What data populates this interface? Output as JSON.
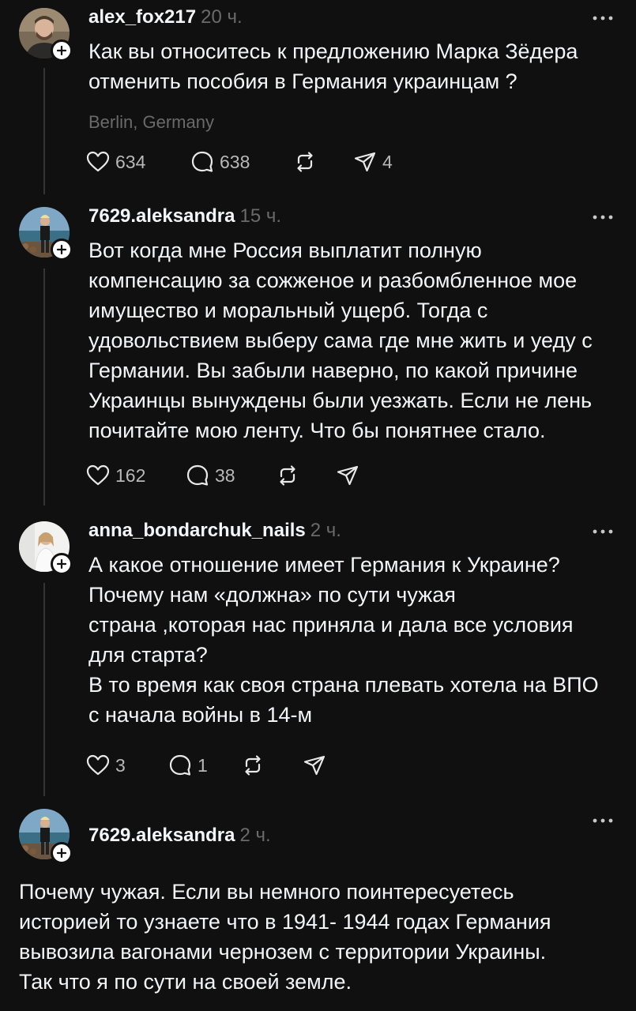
{
  "posts": [
    {
      "username": "alex_fox217",
      "time": "20 ч.",
      "lines": [
        "Как вы относитесь к предложению  Марка Зёдера",
        "отменить пособия в Германия украинцам ?"
      ],
      "location": "Berlin, Germany",
      "likes": "634",
      "replies": "638",
      "shares": "4"
    },
    {
      "username": "7629.aleksandra",
      "time": "15 ч.",
      "lines": [
        "Вот когда мне Россия выплатит полную",
        "компенсацию за сожженое и разбомбленное мое",
        "имущество и моральный ущерб. Тогда с",
        "удовольствием выберу сама где мне жить и уеду с",
        "Германии.  Вы забыли наверно, по какой причине",
        "Украинцы вынуждены были уезжать.  Если не лень",
        "почитайте мою ленту.  Что бы понятнее стало."
      ],
      "likes": "162",
      "replies": "38"
    },
    {
      "username": "anna_bondarchuk_nails",
      "time": "2 ч.",
      "lines": [
        "А какое отношение имеет Германия к Украине?",
        "Почему нам «должна» по сути чужая",
        "страна ,которая нас приняла и дала все условия",
        "для старта?",
        "В то время как своя страна плевать хотела на ВПО",
        "с начала войны в 14-м"
      ],
      "likes": "3",
      "replies": "1"
    },
    {
      "username": "7629.aleksandra",
      "time": "2 ч.",
      "lines": [
        "Почему чужая. Если вы немного поинтересуетесь",
        "историей то узнаете что в 1941- 1944 годах Германия",
        "вывозила вагонами чернозем с территории Украины.",
        "Так что я по сути на своей земле."
      ]
    }
  ],
  "colors": {
    "background": "#101010",
    "text": "#f3f5f7",
    "muted": "#6a6a6a",
    "thread_line": "#333638"
  },
  "icons": [
    "plus-icon",
    "more-icon",
    "heart-icon",
    "comment-icon",
    "repost-icon",
    "share-icon"
  ]
}
